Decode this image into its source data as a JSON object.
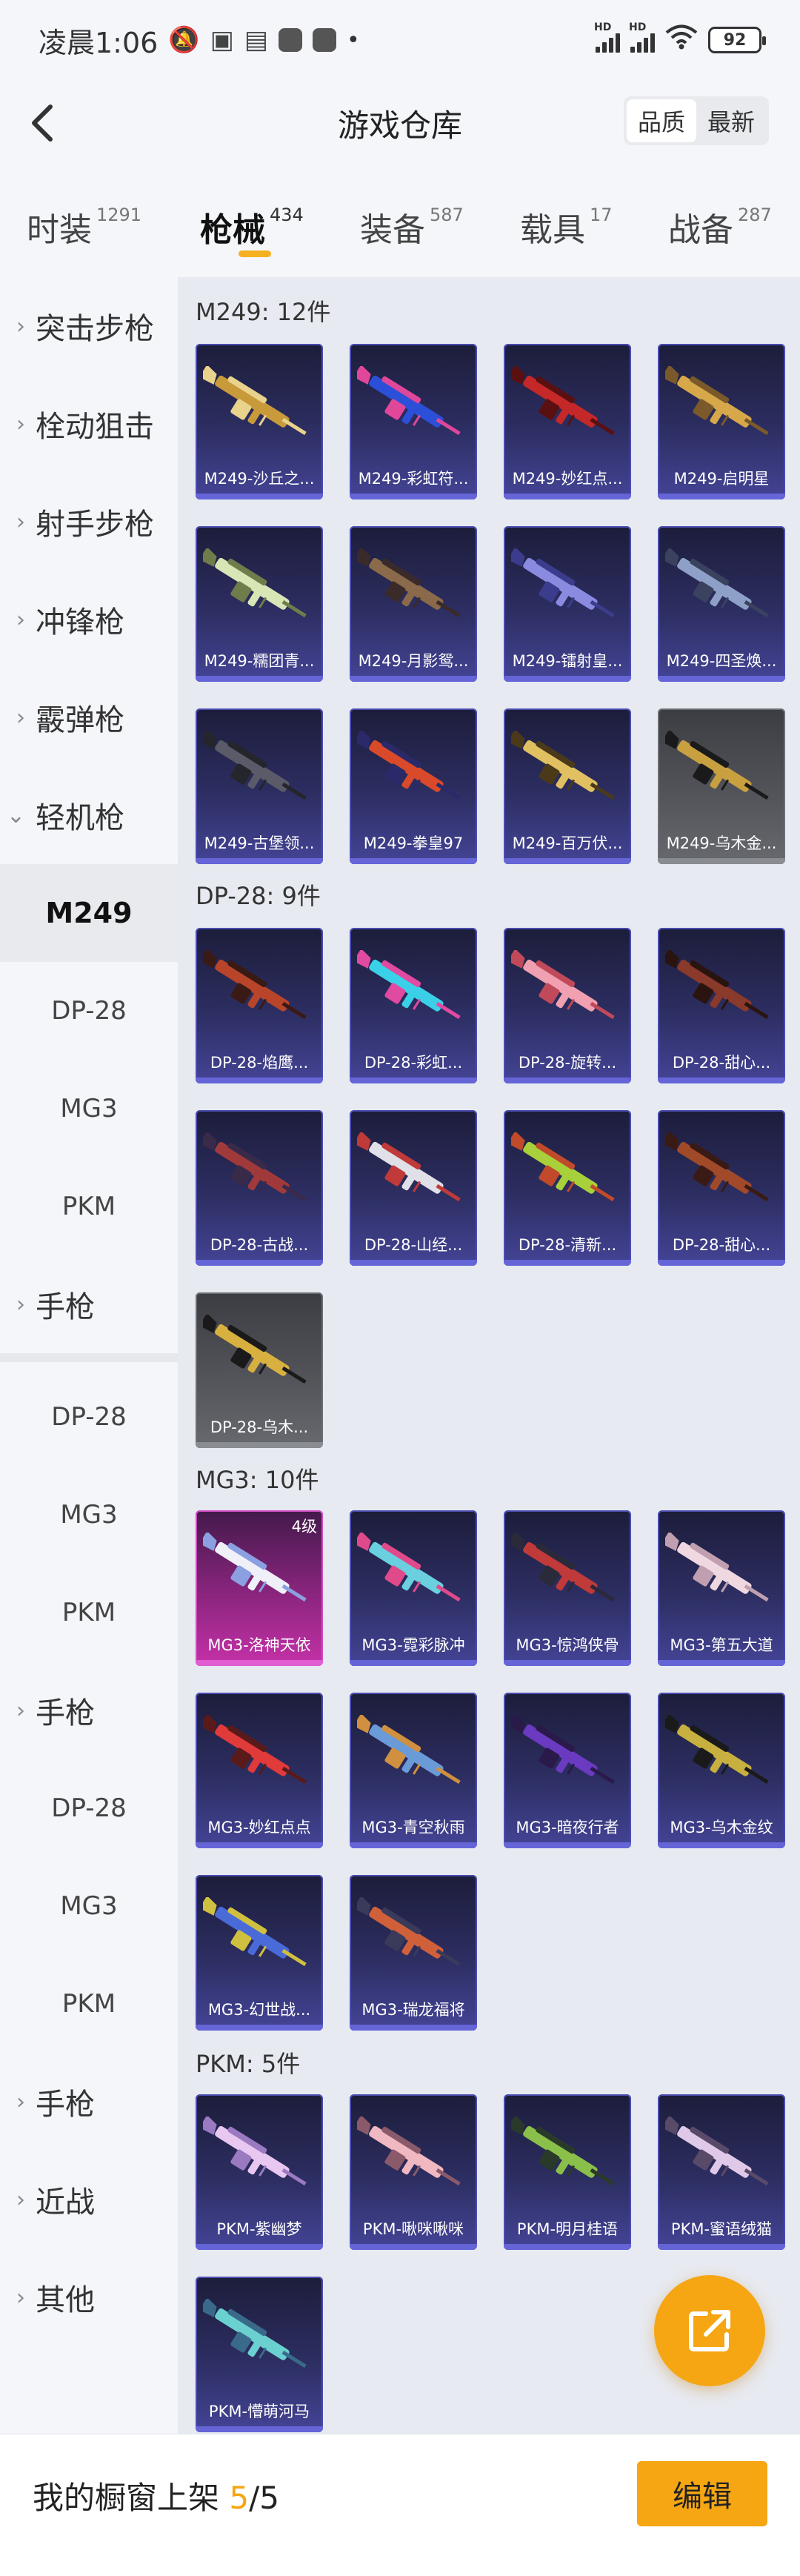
{
  "status_bar": {
    "time": "凌晨1:06",
    "battery": "92"
  },
  "header": {
    "title": "游戏仓库",
    "sort": [
      "品质",
      "最新"
    ]
  },
  "tabs": [
    {
      "label": "时装",
      "count": "1291"
    },
    {
      "label": "枪械",
      "count": "434"
    },
    {
      "label": "装备",
      "count": "587"
    },
    {
      "label": "载具",
      "count": "17"
    },
    {
      "label": "战备",
      "count": "287"
    }
  ],
  "sidebar": {
    "assault": "突击步枪",
    "bolt": "栓动狙击",
    "dmr": "射手步枪",
    "smg": "冲锋枪",
    "shotgun": "霰弹枪",
    "lmg": "轻机枪",
    "sub1": [
      "M249",
      "DP-28",
      "MG3",
      "PKM"
    ],
    "pistol": "手枪",
    "sub2": [
      "DP-28",
      "MG3",
      "PKM"
    ],
    "sub3": [
      "DP-28",
      "MG3",
      "PKM"
    ],
    "melee": "近战",
    "other": "其他"
  },
  "sections": {
    "m249": {
      "title": "M249: 12件",
      "items": [
        "M249-沙丘之...",
        "M249-彩虹符...",
        "M249-妙红点...",
        "M249-启明星",
        "M249-糯团青...",
        "M249-月影鸳...",
        "M249-镭射皇...",
        "M249-四圣焕...",
        "M249-古堡领...",
        "M249-拳皇97",
        "M249-百万伏...",
        "M249-乌木金..."
      ]
    },
    "dp28": {
      "title": "DP-28: 9件",
      "items": [
        "DP-28-焰鹰...",
        "DP-28-彩虹...",
        "DP-28-旋转...",
        "DP-28-甜心...",
        "DP-28-古战...",
        "DP-28-山经...",
        "DP-28-清新...",
        "DP-28-甜心...",
        "DP-28-乌木..."
      ]
    },
    "mg3": {
      "title": "MG3: 10件",
      "level_badge": "4级",
      "items": [
        "MG3-洛神天依",
        "MG3-霓彩脉冲",
        "MG3-惊鸿侠骨",
        "MG3-第五大道",
        "MG3-妙红点点",
        "MG3-青空秋雨",
        "MG3-暗夜行者",
        "MG3-乌木金纹",
        "MG3-幻世战...",
        "MG3-瑞龙福将"
      ]
    },
    "pkm": {
      "title": "PKM: 5件",
      "items": [
        "PKM-紫幽梦",
        "PKM-啾咪啾咪",
        "PKM-明月桂语",
        "PKM-蜜语绒猫",
        "PKM-懵萌河马"
      ]
    }
  },
  "bottom": {
    "label": "我的橱窗上架 ",
    "current": "5",
    "total": "/5",
    "edit": "编辑"
  }
}
